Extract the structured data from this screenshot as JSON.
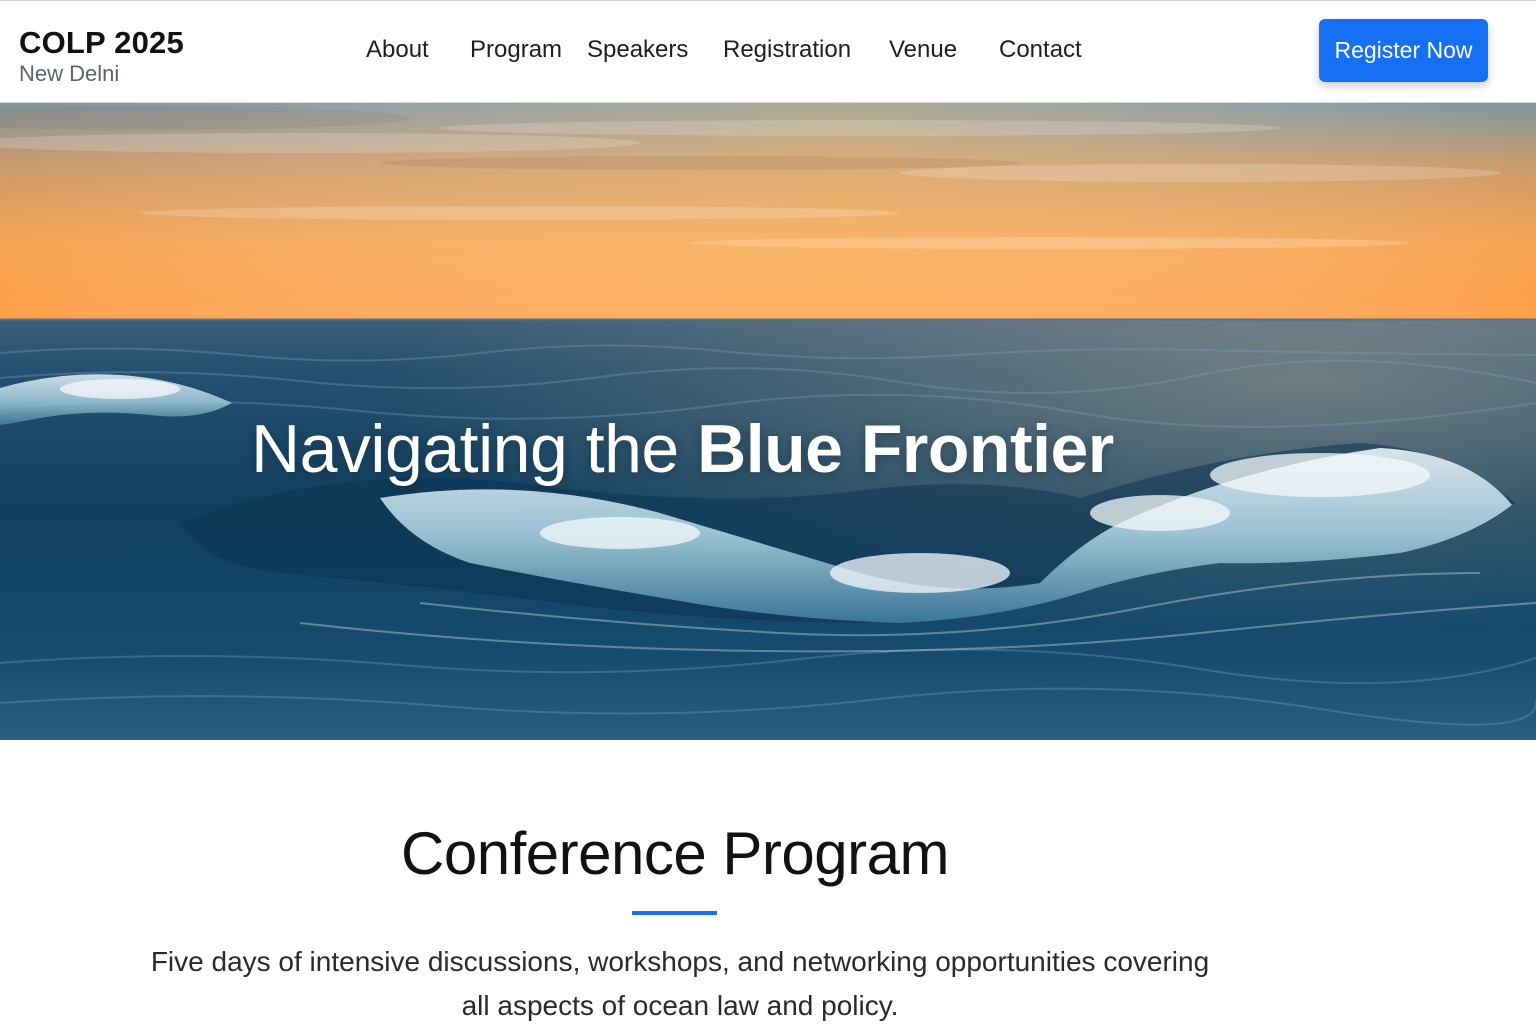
{
  "brand": {
    "title": "COLP 2025",
    "subtitle": "New Delni"
  },
  "nav": {
    "items": [
      {
        "label": "About"
      },
      {
        "label": "Program"
      },
      {
        "label": "Speakers"
      },
      {
        "label": "Registration"
      },
      {
        "label": "Venue"
      },
      {
        "label": "Contact"
      }
    ]
  },
  "cta": {
    "label": "Register Now"
  },
  "hero": {
    "title_lead": "Navigating the ",
    "title_accent": "Blue Frontier"
  },
  "program": {
    "title": "Conference Program",
    "description": "Five days of intensive discussions, workshops, and networking opportunities covering all aspects of ocean law and policy."
  },
  "colors": {
    "accent": "#1670f5",
    "text": "#111111",
    "muted": "#5a6470",
    "sky_top": "#6f8f9e",
    "sky_horizon": "#ff9f45",
    "ocean_deep": "#0d3a5c",
    "foam": "#dfeef5"
  }
}
